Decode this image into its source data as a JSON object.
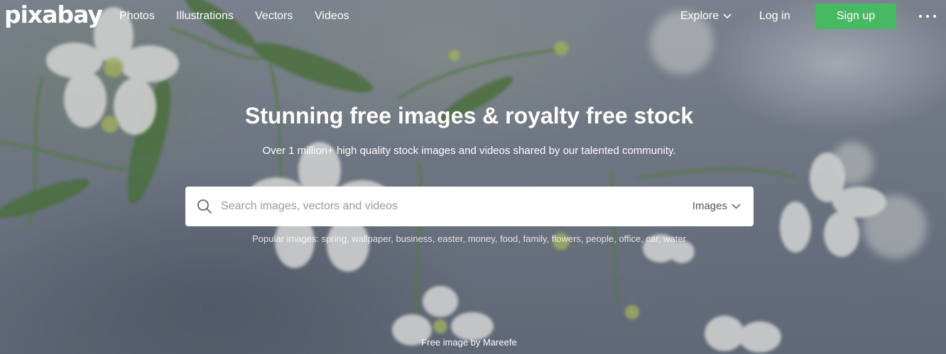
{
  "header": {
    "logo": "pixabay",
    "nav": [
      "Photos",
      "Illustrations",
      "Vectors",
      "Videos"
    ],
    "explore_label": "Explore",
    "login_label": "Log in",
    "signup_label": "Sign up",
    "more_icon": "more-horizontal-icon"
  },
  "hero": {
    "headline": "Stunning free images & royalty free stock",
    "subline": "Over 1 million+ high quality stock images and videos shared by our talented community."
  },
  "search": {
    "placeholder": "Search images, vectors and videos",
    "value": "",
    "type_selected": "Images",
    "icon": "search-icon"
  },
  "popular": {
    "label": "Popular images:",
    "tags": [
      "spring",
      "wallpaper",
      "business",
      "easter",
      "money",
      "food",
      "family",
      "flowers",
      "people",
      "office",
      "car",
      "water"
    ]
  },
  "credit": "Free image by Mareefe",
  "colors": {
    "signup_bg": "#48b963",
    "text_white": "#ffffff"
  }
}
